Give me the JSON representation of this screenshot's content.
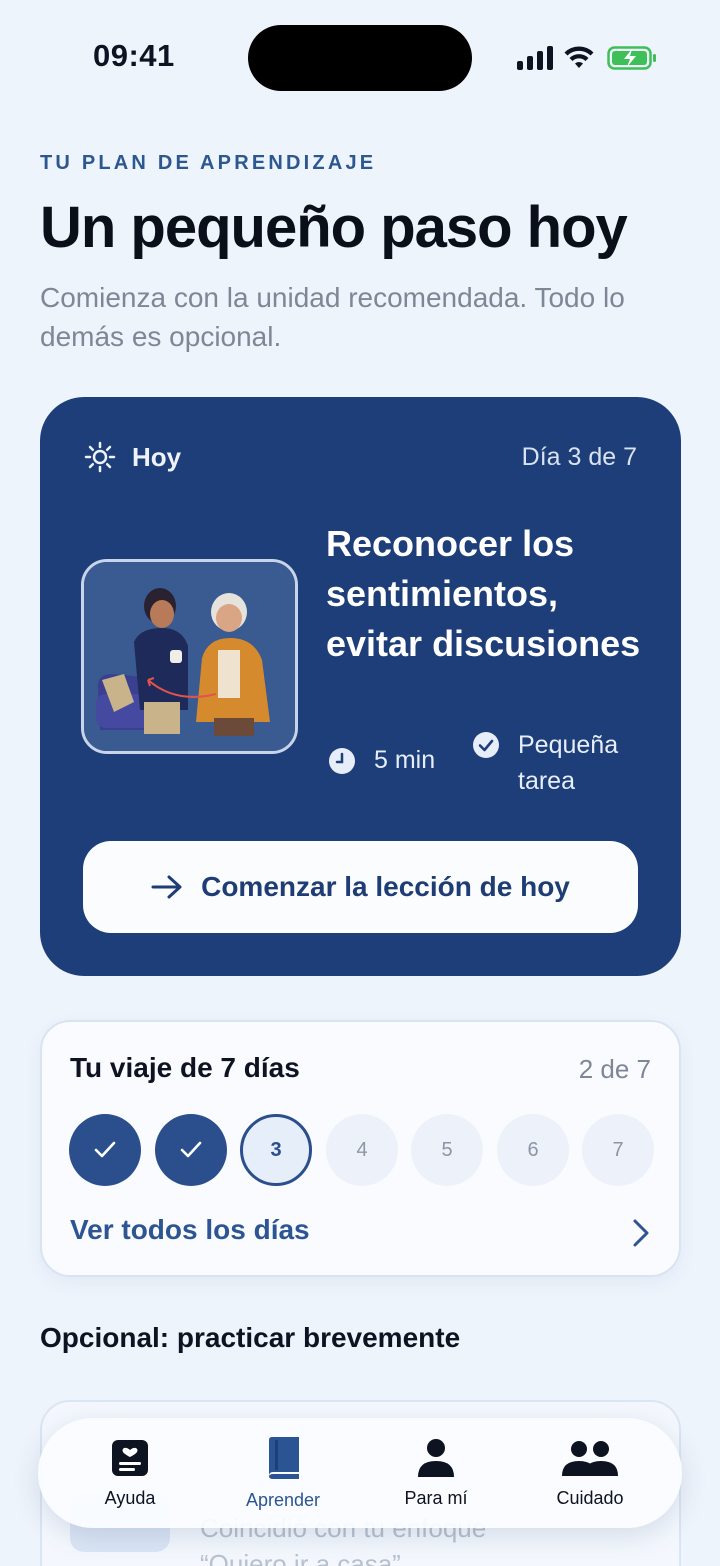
{
  "status_bar": {
    "time": "09:41"
  },
  "header": {
    "eyebrow": "TU PLAN DE APRENDIZAJE",
    "title": "Un pequeño paso hoy",
    "subtitle": "Comienza con la unidad recomendada. Todo lo demás es opcional."
  },
  "hero": {
    "today_label": "Hoy",
    "day_counter": "Día 3 de 7",
    "lesson_title": "Reconocer los sentimientos, evitar discusiones",
    "duration": "5 min",
    "task_label": "Pequeña tarea",
    "start_button": "Comenzar la lección de hoy",
    "colors": {
      "card": "#1d3e78",
      "button_text": "#1e3d75"
    }
  },
  "journey": {
    "title": "Tu viaje de 7 días",
    "progress": "2 de 7",
    "days": [
      {
        "label": "1",
        "state": "done"
      },
      {
        "label": "2",
        "state": "done"
      },
      {
        "label": "3",
        "state": "current"
      },
      {
        "label": "4",
        "state": "todo"
      },
      {
        "label": "5",
        "state": "todo"
      },
      {
        "label": "6",
        "state": "todo"
      },
      {
        "label": "7",
        "state": "todo"
      }
    ],
    "see_all": "Ver todos los días"
  },
  "practice": {
    "title": "Opcional: practicar brevemente",
    "peek_lines": [
      "Coincidió con tu enfoque",
      "“Quiero ir a casa”"
    ]
  },
  "tab_bar": {
    "active": "Aprender",
    "tabs": [
      {
        "label": "Ayuda",
        "icon": "heart-card-icon"
      },
      {
        "label": "Aprender",
        "icon": "book-icon"
      },
      {
        "label": "Para mí",
        "icon": "person-icon"
      },
      {
        "label": "Cuidado",
        "icon": "people-icon"
      }
    ]
  }
}
